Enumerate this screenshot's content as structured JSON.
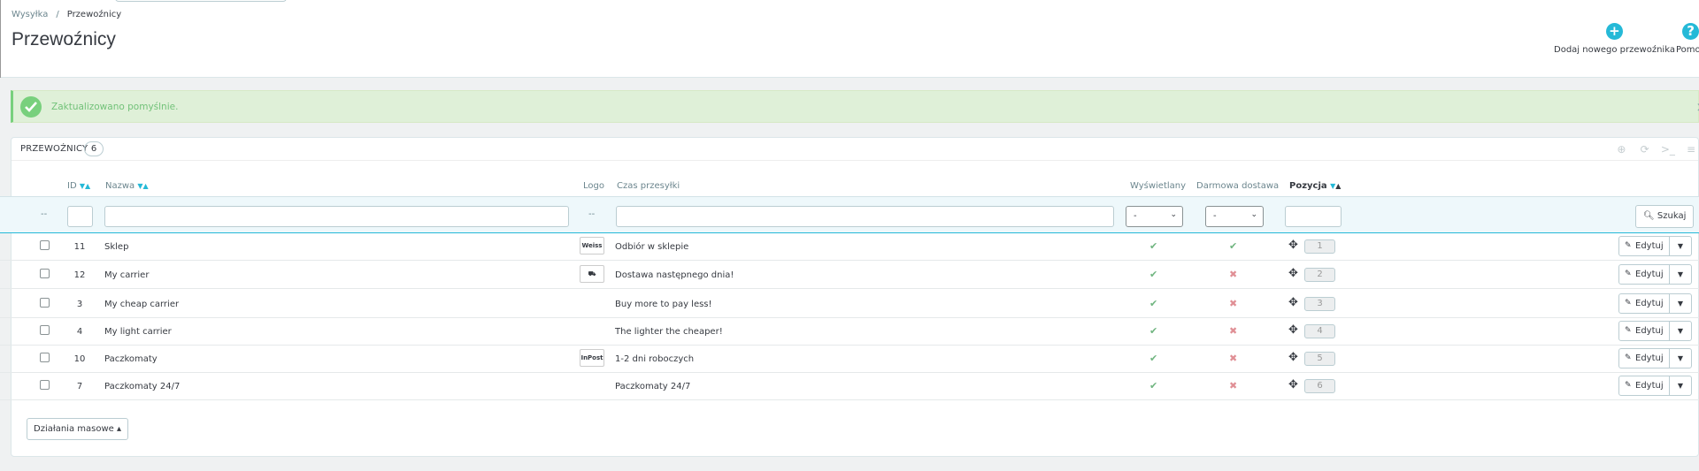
{
  "breadcrumb": {
    "parent": "Wysyłka",
    "separator": "/",
    "current": "Przewoźnicy"
  },
  "page_title": "Przewoźnicy",
  "toolbar": {
    "add_icon": "+",
    "add_label": "Dodaj nowego przewoźnika",
    "help_icon": "?",
    "help_label": "Pomoc"
  },
  "alert": {
    "message": "Zaktualizowano pomyślnie.",
    "close": "×"
  },
  "panel": {
    "title": "Przewoźnicy",
    "count": "6"
  },
  "columns": {
    "id": "ID",
    "name": "Nazwa",
    "logo": "Logo",
    "delay": "Czas przesyłki",
    "active": "Wyświetlany",
    "free": "Darmowa dostawa",
    "position": "Pozycja"
  },
  "filters": {
    "bulk_placeholder": "--",
    "logo_placeholder": "--",
    "active_value": "-",
    "free_value": "-",
    "search_label": "Szukaj"
  },
  "rows": [
    {
      "id": "11",
      "name": "Sklep",
      "logo": "Weiss",
      "delay": "Odbiór w sklepie",
      "active": "✔",
      "free": "✔",
      "position": "1"
    },
    {
      "id": "12",
      "name": "My carrier",
      "logo": "⛟",
      "delay": "Dostawa następnego dnia!",
      "active": "✔",
      "free": "✖",
      "position": "2"
    },
    {
      "id": "3",
      "name": "My cheap carrier",
      "logo": "",
      "delay": "Buy more to pay less!",
      "active": "✔",
      "free": "✖",
      "position": "3"
    },
    {
      "id": "4",
      "name": "My light carrier",
      "logo": "",
      "delay": "The lighter the cheaper!",
      "active": "✔",
      "free": "✖",
      "position": "4"
    },
    {
      "id": "10",
      "name": "Paczkomaty",
      "logo": "InPost",
      "delay": "1-2 dni roboczych",
      "active": "✔",
      "free": "✖",
      "position": "5"
    },
    {
      "id": "7",
      "name": "Paczkomaty 24/7",
      "logo": "",
      "delay": "Paczkomaty 24/7",
      "active": "✔",
      "free": "✖",
      "position": "6"
    }
  ],
  "row_actions": {
    "edit_label": "Edytuj"
  },
  "bulk_actions": {
    "label": "Działania masowe"
  },
  "colors": {
    "accent": "#25b9d7",
    "success": "#70b580",
    "danger": "#e08f95",
    "alert_bg": "#dff0d8"
  }
}
